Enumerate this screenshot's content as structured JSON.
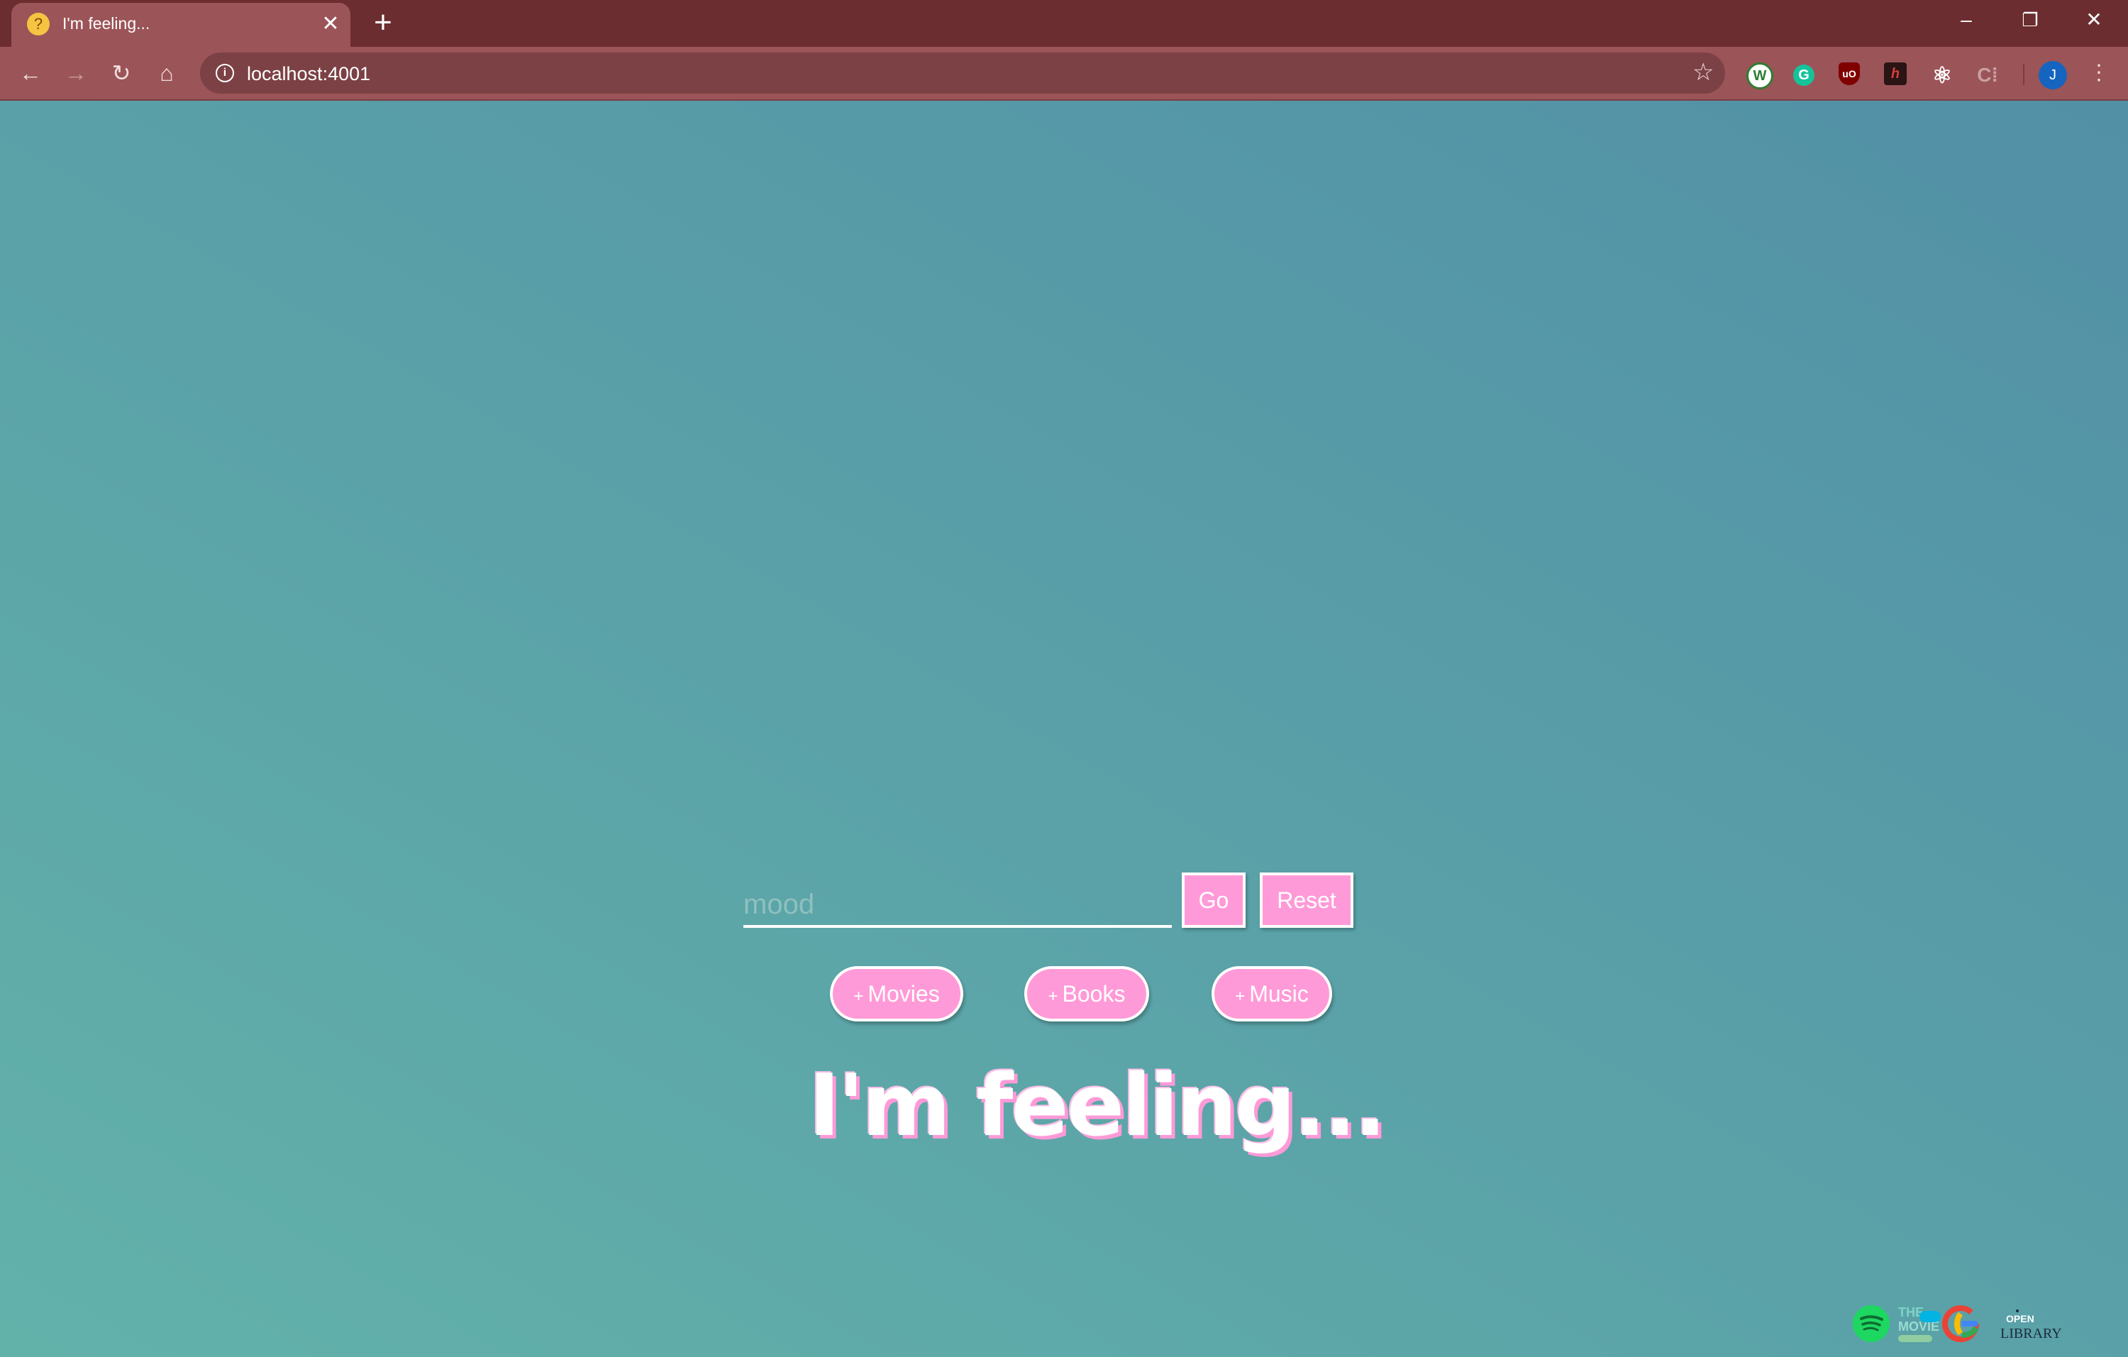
{
  "browser": {
    "tab_title": "I'm feeling...",
    "url": "localhost:4001",
    "favicon": "thinking-face-emoji",
    "accent": "#9b5458",
    "frame_color": "#6b2d2f",
    "profile_initial": "J",
    "extensions": [
      "w-extension-icon",
      "grammarly-icon",
      "ublock-origin-icon",
      "hypothesis-icon",
      "react-devtools-icon",
      "extension-icon"
    ]
  },
  "search": {
    "placeholder": "mood",
    "go_label": "Go",
    "reset_label": "Reset"
  },
  "categories": {
    "plus": "+",
    "movies": "Movies",
    "books": "Books",
    "music": "Music"
  },
  "headline": "I'm feeling...",
  "colors": {
    "background_start": "#63b2aa",
    "background_end": "#5290a6",
    "button_pink": "#ff9ad8",
    "text": "#ffffff"
  },
  "footer": {
    "logos": [
      "spotify-logo",
      "the-movie-db-logo",
      "google-logo",
      "open-library-logo"
    ],
    "moviedb_text_top": "THE",
    "moviedb_text_bottom": "MOVIE",
    "openlibrary_text_top": "OPEN",
    "openlibrary_text_bottom": "LIBRARY"
  }
}
